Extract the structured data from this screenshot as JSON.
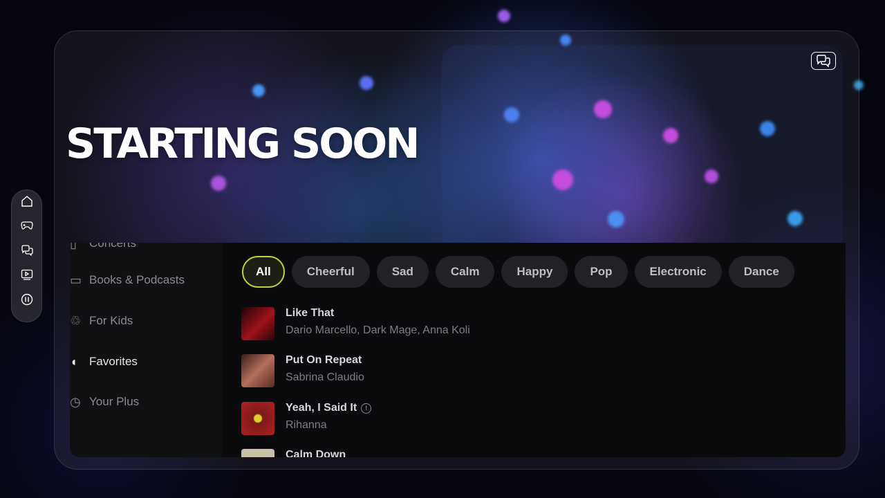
{
  "banner": {
    "title": "STARTING SOON"
  },
  "header": {
    "chat_icon": "chat-bubbles-icon"
  },
  "rail": {
    "items": [
      {
        "icon": "home-icon"
      },
      {
        "icon": "gamepad-icon"
      },
      {
        "icon": "chat-icon"
      },
      {
        "icon": "video-icon"
      },
      {
        "icon": "pause-icon"
      }
    ]
  },
  "sidebar": {
    "items": [
      {
        "label": "Concerts",
        "icon": "concert-icon"
      },
      {
        "label": "Books & Podcasts",
        "icon": "book-icon"
      },
      {
        "label": "For Kids",
        "icon": "kids-icon"
      },
      {
        "label": "Favorites",
        "icon": "favorites-icon",
        "active": true
      },
      {
        "label": "Your Plus",
        "icon": "plus-icon"
      }
    ]
  },
  "filters": {
    "chips": [
      {
        "label": "All",
        "active": true
      },
      {
        "label": "Cheerful"
      },
      {
        "label": "Sad"
      },
      {
        "label": "Calm"
      },
      {
        "label": "Happy"
      },
      {
        "label": "Pop"
      },
      {
        "label": "Electronic"
      },
      {
        "label": "Dance"
      }
    ]
  },
  "tracks": [
    {
      "title": "Like That",
      "artist": "Dario Marcello, Dark Mage, Anna Koli",
      "cover_color": "#a0121a"
    },
    {
      "title": "Put On Repeat",
      "artist": "Sabrina Claudio",
      "cover_color": "#7a3b2c"
    },
    {
      "title": "Yeah, I Said It",
      "artist": "Rihanna",
      "explicit": true,
      "cover_color": "#8c1c1c"
    },
    {
      "title": "Calm Down",
      "artist": "",
      "cover_color": "#c9c0a8"
    }
  ],
  "colors": {
    "accent": "#c1cf3a",
    "panel": "#0b0b0d"
  }
}
